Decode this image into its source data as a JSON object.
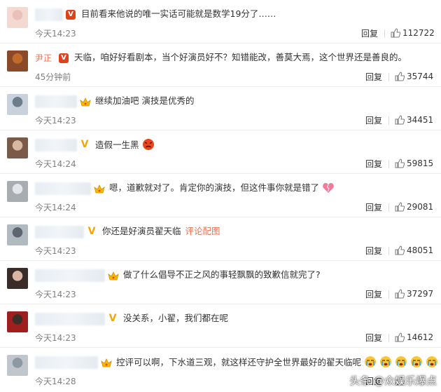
{
  "comments": [
    {
      "name": "",
      "text": "目前看来他说的唯一实话可能就是数学19分了……",
      "time": "今天14:23",
      "reply": "回复",
      "likes": "112722",
      "badge": "v-red"
    },
    {
      "name": "尹正",
      "text": "天临，咱好好看剧本，当个好演员好不？知错能改，善莫大焉，这个世界还是善良的。",
      "time": "45分钟前",
      "reply": "回复",
      "likes": "35744",
      "badge": "v-red"
    },
    {
      "name": "",
      "text": "继续加油吧 演技是优秀的",
      "time": "今天14:23",
      "reply": "回复",
      "likes": "34451",
      "badge": "crown"
    },
    {
      "name": "",
      "text": "造假一生黑",
      "time": "今天14:24",
      "reply": "回复",
      "likes": "59815",
      "badge": "v-gold",
      "emoji": "angry"
    },
    {
      "name": "",
      "text": "嗯，道歉就对了。肯定你的演技，但这件事你就是错了",
      "time": "今天14:24",
      "reply": "回复",
      "likes": "29081",
      "badge": "crown",
      "emoji": "heart"
    },
    {
      "name": "",
      "text": "你还是好演员翟天临",
      "link": "评论配图",
      "time": "今天14:23",
      "reply": "回复",
      "likes": "48051",
      "badge": "v-gold"
    },
    {
      "name": "",
      "text": "做了什么倡导不正之风的事轻飘飘的致歉信就完了?",
      "time": "今天14:23",
      "reply": "回复",
      "likes": "37297",
      "badge": "crown"
    },
    {
      "name": "",
      "text": "没关系，小翟，我们都在呢",
      "time": "今天14:23",
      "reply": "回复",
      "likes": "14612",
      "badge": "v-gold"
    },
    {
      "name": "",
      "text": "控评可以啊，下水道三观，就这样还守护全世界最好的翟天临呢",
      "time": "今天14:28",
      "reply": "回复",
      "likes": "",
      "badge": "crown",
      "emoji": "cry"
    }
  ],
  "watermark": "头条 @众娱乐爆点"
}
